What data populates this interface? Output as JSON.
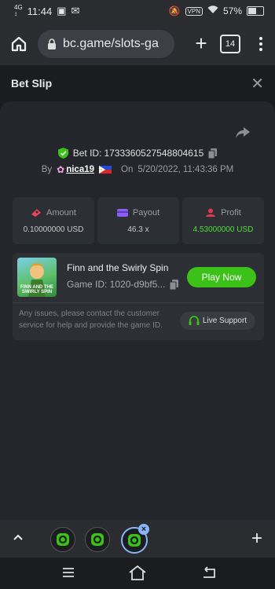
{
  "status": {
    "net_top": "4G",
    "net_bottom": "↕",
    "time": "11:44",
    "vpn": "VPN",
    "battery_pct": "57%",
    "battery_level": 0.57
  },
  "browser": {
    "url": "bc.game/slots-ga",
    "tab_count": "14"
  },
  "modal": {
    "title": "Bet Slip"
  },
  "bet": {
    "bet_id_label": "Bet ID:",
    "bet_id": "1733360527548804615",
    "by_label": "By",
    "username": "nica19",
    "on_label": "On",
    "datetime": "5/20/2022, 11:43:36 PM"
  },
  "stats": {
    "amount": {
      "label": "Amount",
      "value": "0.10000000 USD"
    },
    "payout": {
      "label": "Payout",
      "value": "46.3 x"
    },
    "profit": {
      "label": "Profit",
      "value": "4.53000000 USD"
    }
  },
  "game": {
    "name": "Finn and the Swirly Spin",
    "thumb_text": "FINN AND THE SWIRLY SPIN",
    "game_id": "Game ID: 1020-d9bf5...",
    "play_label": "Play Now",
    "notice": "Any issues, please contact the customer service for help and provide the game ID.",
    "support_label": "Live Support"
  },
  "colors": {
    "accent_green": "#3bc117",
    "profit_green": "#4fdc3a",
    "amount_icon": "#e8455a",
    "payout_icon": "#8b5cf6",
    "profit_icon": "#e5384d",
    "tab_highlight": "#8ab4f8"
  }
}
